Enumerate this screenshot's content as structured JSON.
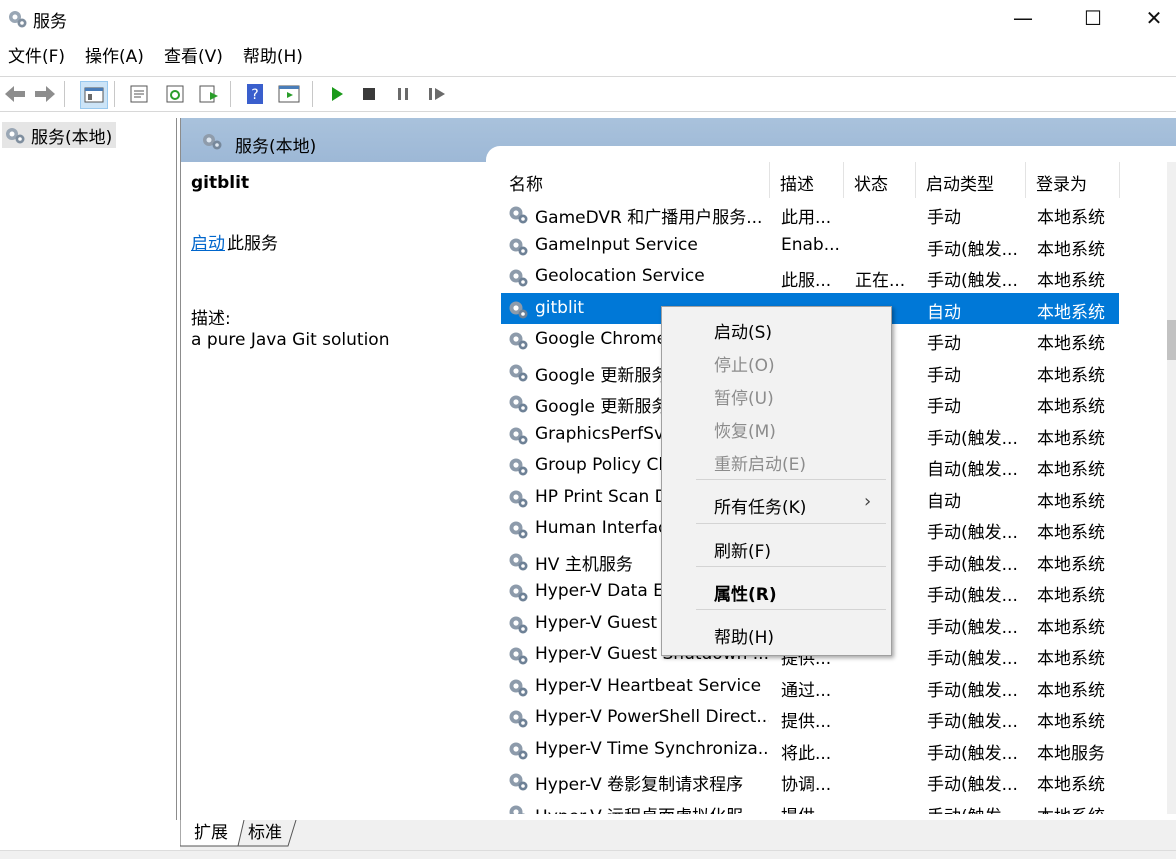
{
  "window": {
    "title": "服务",
    "minimize": "—",
    "maximize": "☐",
    "close": "✕"
  },
  "menubar": [
    "文件(F)",
    "操作(A)",
    "查看(V)",
    "帮助(H)"
  ],
  "tree": {
    "root_label": "服务(本地)"
  },
  "main": {
    "header_title": "服务(本地)",
    "selected_name": "gitblit",
    "start_link": "启动",
    "start_suffix": "此服务",
    "desc_label": "描述:",
    "desc_text": "a pure Java Git solution"
  },
  "table": {
    "columns": [
      "名称",
      "描述",
      "状态",
      "启动类型",
      "登录为"
    ],
    "sort_indicator": "^",
    "rows": [
      {
        "name": "GameDVR 和广播用户服务...",
        "desc": "此用...",
        "state": "",
        "start": "手动",
        "logon": "本地系统"
      },
      {
        "name": "GameInput Service",
        "desc": "Enab...",
        "state": "",
        "start": "手动(触发...",
        "logon": "本地系统"
      },
      {
        "name": "Geolocation Service",
        "desc": "此服...",
        "state": "正在...",
        "start": "手动(触发...",
        "logon": "本地系统"
      },
      {
        "name": "gitblit",
        "desc": "",
        "state": "",
        "start": "自动",
        "logon": "本地系统",
        "selected": true
      },
      {
        "name": "Google Chrome",
        "desc": "",
        "state": "",
        "start": "手动",
        "logon": "本地系统"
      },
      {
        "name": "Google 更新服务",
        "desc": "",
        "state": "",
        "start": "手动",
        "logon": "本地系统"
      },
      {
        "name": "Google 更新服务",
        "desc": "",
        "state": "",
        "start": "手动",
        "logon": "本地系统"
      },
      {
        "name": "GraphicsPerfSvc",
        "desc": "",
        "state": "",
        "start": "手动(触发...",
        "logon": "本地系统"
      },
      {
        "name": "Group Policy Cli",
        "desc": "",
        "state": "",
        "start": "自动(触发...",
        "logon": "本地系统"
      },
      {
        "name": "HP Print Scan D",
        "desc": "",
        "state": "...",
        "start": "自动",
        "logon": "本地系统"
      },
      {
        "name": "Human Interface",
        "desc": "",
        "state": "...",
        "start": "手动(触发...",
        "logon": "本地系统"
      },
      {
        "name": "HV 主机服务",
        "desc": "",
        "state": "",
        "start": "手动(触发...",
        "logon": "本地系统"
      },
      {
        "name": "Hyper-V Data Ex",
        "desc": "",
        "state": "",
        "start": "手动(触发...",
        "logon": "本地系统"
      },
      {
        "name": "Hyper-V Guest S",
        "desc": "",
        "state": "",
        "start": "手动(触发...",
        "logon": "本地系统"
      },
      {
        "name": "Hyper-V Guest Shutdown ...",
        "desc": "提供...",
        "state": "",
        "start": "手动(触发...",
        "logon": "本地系统"
      },
      {
        "name": "Hyper-V Heartbeat Service",
        "desc": "通过...",
        "state": "",
        "start": "手动(触发...",
        "logon": "本地系统"
      },
      {
        "name": "Hyper-V PowerShell Direct...",
        "desc": "提供...",
        "state": "",
        "start": "手动(触发...",
        "logon": "本地系统"
      },
      {
        "name": "Hyper-V Time Synchroniza...",
        "desc": "将此...",
        "state": "",
        "start": "手动(触发...",
        "logon": "本地服务"
      },
      {
        "name": "Hyper-V 卷影复制请求程序",
        "desc": "协调...",
        "state": "",
        "start": "手动(触发...",
        "logon": "本地系统"
      },
      {
        "name": "Hyper-V 远程桌面虚拟化服...",
        "desc": "提供...",
        "state": "",
        "start": "手动(触发...",
        "logon": "本地系统"
      }
    ]
  },
  "context_menu": {
    "items": [
      {
        "label": "启动(S)",
        "disabled": false
      },
      {
        "label": "停止(O)",
        "disabled": true
      },
      {
        "label": "暂停(U)",
        "disabled": true
      },
      {
        "label": "恢复(M)",
        "disabled": true
      },
      {
        "label": "重新启动(E)",
        "disabled": true
      },
      {
        "label": "所有任务(K)",
        "disabled": false,
        "submenu": true
      },
      {
        "label": "刷新(F)",
        "disabled": false
      },
      {
        "label": "属性(R)",
        "disabled": false,
        "bold": true
      },
      {
        "label": "帮助(H)",
        "disabled": false
      }
    ],
    "submenu_arrow": "›"
  },
  "tabs": [
    "扩展",
    "标准"
  ],
  "colors": {
    "selection": "#0078d7",
    "header": "#a9c2dc",
    "link": "#0066cc"
  },
  "icons": [
    "gear-icon",
    "back-arrow-icon",
    "forward-arrow-icon",
    "play-icon",
    "stop-icon",
    "pause-icon",
    "resume-icon",
    "help-icon"
  ]
}
